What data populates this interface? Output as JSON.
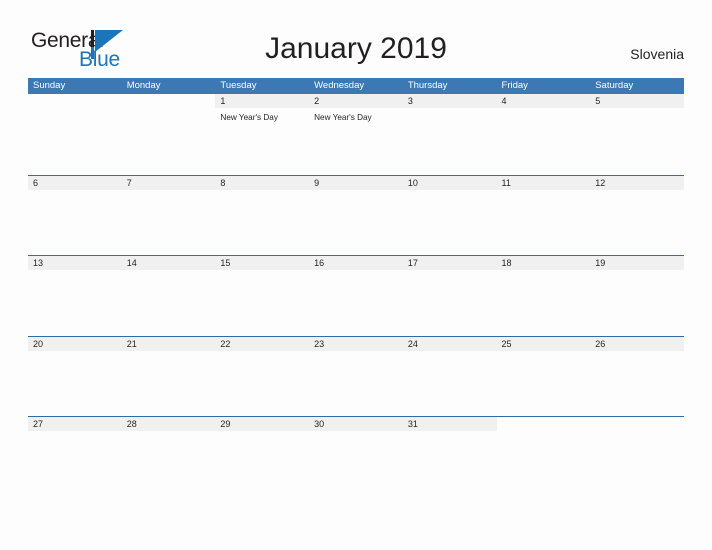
{
  "brand": {
    "name_part1": "General",
    "name_part2": "Blue",
    "flag_color": "#1b75bb"
  },
  "header": {
    "title": "January 2019",
    "locale": "Slovenia"
  },
  "calendar": {
    "accent_color": "#3b78b4",
    "band_color": "#f0f0f0",
    "weekdays": [
      "Sunday",
      "Monday",
      "Tuesday",
      "Wednesday",
      "Thursday",
      "Friday",
      "Saturday"
    ],
    "weeks": [
      [
        {
          "date": "",
          "event": ""
        },
        {
          "date": "",
          "event": ""
        },
        {
          "date": "1",
          "event": "New Year's Day"
        },
        {
          "date": "2",
          "event": "New Year's Day"
        },
        {
          "date": "3",
          "event": ""
        },
        {
          "date": "4",
          "event": ""
        },
        {
          "date": "5",
          "event": ""
        }
      ],
      [
        {
          "date": "6",
          "event": ""
        },
        {
          "date": "7",
          "event": ""
        },
        {
          "date": "8",
          "event": ""
        },
        {
          "date": "9",
          "event": ""
        },
        {
          "date": "10",
          "event": ""
        },
        {
          "date": "11",
          "event": ""
        },
        {
          "date": "12",
          "event": ""
        }
      ],
      [
        {
          "date": "13",
          "event": ""
        },
        {
          "date": "14",
          "event": ""
        },
        {
          "date": "15",
          "event": ""
        },
        {
          "date": "16",
          "event": ""
        },
        {
          "date": "17",
          "event": ""
        },
        {
          "date": "18",
          "event": ""
        },
        {
          "date": "19",
          "event": ""
        }
      ],
      [
        {
          "date": "20",
          "event": ""
        },
        {
          "date": "21",
          "event": ""
        },
        {
          "date": "22",
          "event": ""
        },
        {
          "date": "23",
          "event": ""
        },
        {
          "date": "24",
          "event": ""
        },
        {
          "date": "25",
          "event": ""
        },
        {
          "date": "26",
          "event": ""
        }
      ],
      [
        {
          "date": "27",
          "event": ""
        },
        {
          "date": "28",
          "event": ""
        },
        {
          "date": "29",
          "event": ""
        },
        {
          "date": "30",
          "event": ""
        },
        {
          "date": "31",
          "event": ""
        },
        {
          "date": "",
          "event": ""
        },
        {
          "date": "",
          "event": ""
        }
      ]
    ]
  }
}
